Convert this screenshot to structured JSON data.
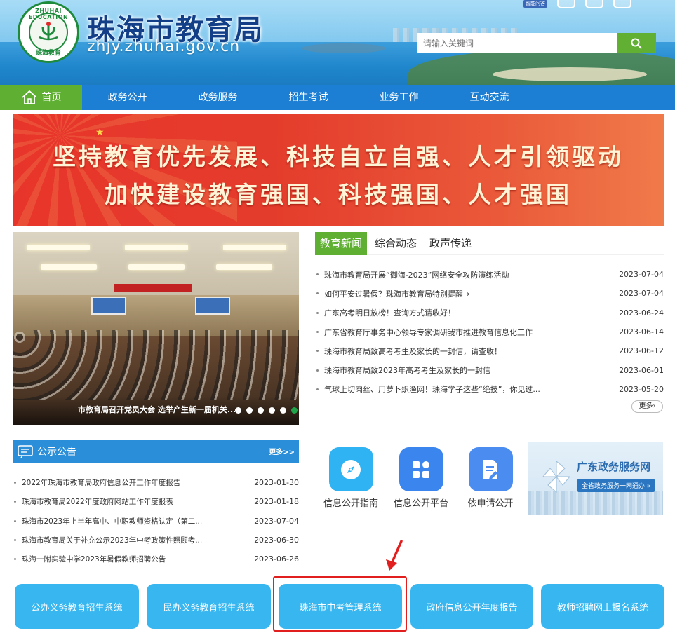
{
  "header": {
    "logo_ring_top": "ZHUHAI EDUCATION",
    "logo_ring_bottom": "珠海教育",
    "site_title": "珠海市教育局",
    "site_domain": "zhjy.zhuhai.gov.cn",
    "tool_badge": "智能问答",
    "search_placeholder": "请输入关键词"
  },
  "nav": {
    "items": [
      "首页",
      "政务公开",
      "政务服务",
      "招生考试",
      "业务工作",
      "互动交流"
    ]
  },
  "banner": {
    "line1": "坚持教育优先发展、科技自立自强、人才引领驱动",
    "line2": "加快建设教育强国、科技强国、人才强国"
  },
  "slider": {
    "caption": "市教育局召开党员大会 选举产生新一届机关...",
    "dot_count": 6,
    "active_dot": 6
  },
  "news": {
    "tabs": [
      "教育新闻",
      "综合动态",
      "政声传递"
    ],
    "items": [
      {
        "title": "珠海市教育局开展“御海-2023”网络安全攻防演练活动",
        "date": "2023-07-04"
      },
      {
        "title": "如何平安过暑假？珠海市教育局特别提醒→",
        "date": "2023-07-04"
      },
      {
        "title": "广东高考明日放榜！查询方式请收好！",
        "date": "2023-06-24"
      },
      {
        "title": "广东省教育厅事务中心领导专家调研我市推进教育信息化工作",
        "date": "2023-06-14"
      },
      {
        "title": "珠海市教育局致高考考生及家长的一封信，请查收！",
        "date": "2023-06-12"
      },
      {
        "title": "珠海市教育局致2023年高考考生及家长的一封信",
        "date": "2023-06-01"
      },
      {
        "title": "气球上切肉丝、用萝卜织渔网！珠海学子这些“绝技”，你见过...",
        "date": "2023-05-20"
      }
    ],
    "more": "更多"
  },
  "notice": {
    "title": "公示公告",
    "more": "更多>>",
    "items": [
      {
        "title": "2022年珠海市教育局政府信息公开工作年度报告",
        "date": "2023-01-30"
      },
      {
        "title": "珠海市教育局2022年度政府网站工作年度报表",
        "date": "2023-01-18"
      },
      {
        "title": "珠海市2023年上半年高中、中职教师资格认定（第二...",
        "date": "2023-07-04"
      },
      {
        "title": "珠海市教育局关于补充公示2023年中考政策性照顾考...",
        "date": "2023-06-30"
      },
      {
        "title": "珠海一附实验中学2023年暑假教师招聘公告",
        "date": "2023-06-26"
      }
    ]
  },
  "quick_links": [
    {
      "label": "信息公开指南",
      "icon": "compass-icon",
      "color": "#2fb3f2"
    },
    {
      "label": "信息公开平台",
      "icon": "grid-apps-icon",
      "color": "#3b86ee"
    },
    {
      "label": "依申请公开",
      "icon": "document-edit-icon",
      "color": "#4a8cf0"
    }
  ],
  "gd_portal": {
    "title": "广东政务服务网",
    "subtitle": "全省政务服务一网通办 »"
  },
  "systems": [
    "公办义务教育招生系统",
    "民办义务教育招生系统",
    "珠海市中考管理系统",
    "政府信息公开年度报告",
    "教师招聘网上报名系统"
  ],
  "colors": {
    "nav_blue": "#1c7fd3",
    "accent_green": "#5fb032",
    "system_button": "#38b6f0",
    "highlight_red": "#e21f1f"
  }
}
